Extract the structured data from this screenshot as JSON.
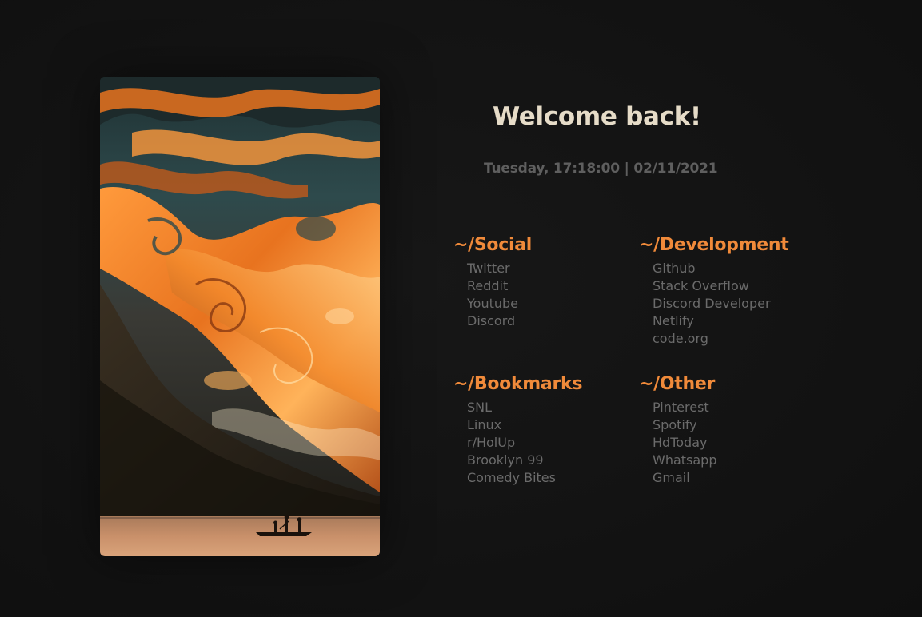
{
  "artwork": {
    "icon": "swirling-orange-paint-mountains-boat-image",
    "colors": {
      "orange": "#f08a3a",
      "teal": "#2e4a4c",
      "mountain": "#2a2319",
      "water": "#c9906a"
    }
  },
  "welcome": {
    "title": "Welcome back!"
  },
  "datetime": {
    "text": "Tuesday, 17:18:00 | 02/11/2021"
  },
  "groups": {
    "social": {
      "title": "~/Social",
      "links": [
        "Twitter",
        "Reddit",
        "Youtube",
        "Discord"
      ]
    },
    "development": {
      "title": "~/Development",
      "links": [
        "Github",
        "Stack Overflow",
        "Discord Developer",
        "Netlify",
        "code.org"
      ]
    },
    "bookmarks": {
      "title": "~/Bookmarks",
      "links": [
        "SNL",
        "Linux",
        "r/HolUp",
        "Brooklyn 99",
        "Comedy Bites"
      ]
    },
    "other": {
      "title": "~/Other",
      "links": [
        "Pinterest",
        "Spotify",
        "HdToday",
        "Whatsapp",
        "Gmail"
      ]
    }
  },
  "theme": {
    "background": "#121212",
    "accent": "#f08a3a",
    "title_color": "#e6dcc8",
    "link_color": "#6b6b6b",
    "datetime_color": "#5f5f5f"
  }
}
